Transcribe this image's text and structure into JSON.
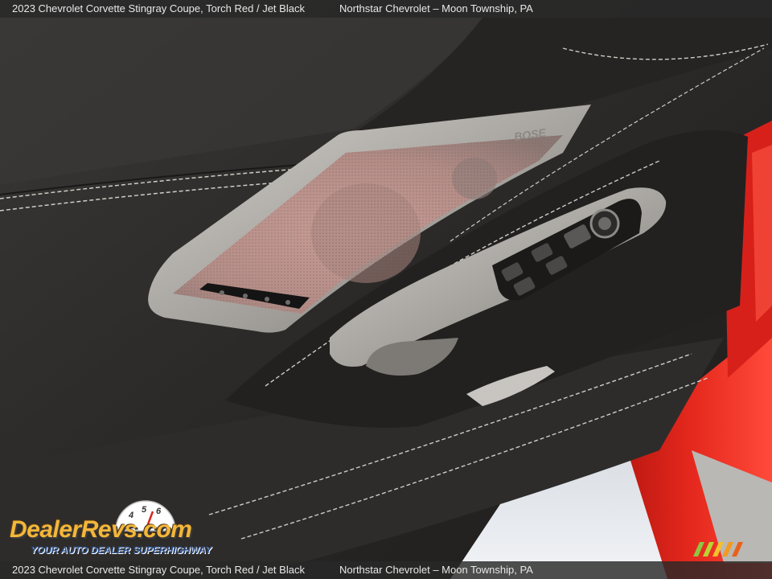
{
  "caption": {
    "vehicle": "2023 Chevrolet Corvette Stingray Coupe,  Torch Red / Jet Black",
    "dealer": "Northstar Chevrolet – Moon Township, PA"
  },
  "watermark": {
    "name": "DealerRevs.com",
    "tagline": "YOUR AUTO DEALER SUPERHIGHWAY",
    "gauge_numbers": [
      "4",
      "5",
      "6"
    ]
  },
  "speaker_badge": "BOSE",
  "colors": {
    "leather": "#2b2927",
    "trim": "#b9b6b1",
    "body_paint": "#e0231b",
    "stitching": "#c9c6c0",
    "caption_bg": "#282828",
    "logo_gold": "#f3b73a",
    "logo_blue": "#2d4f8a"
  }
}
